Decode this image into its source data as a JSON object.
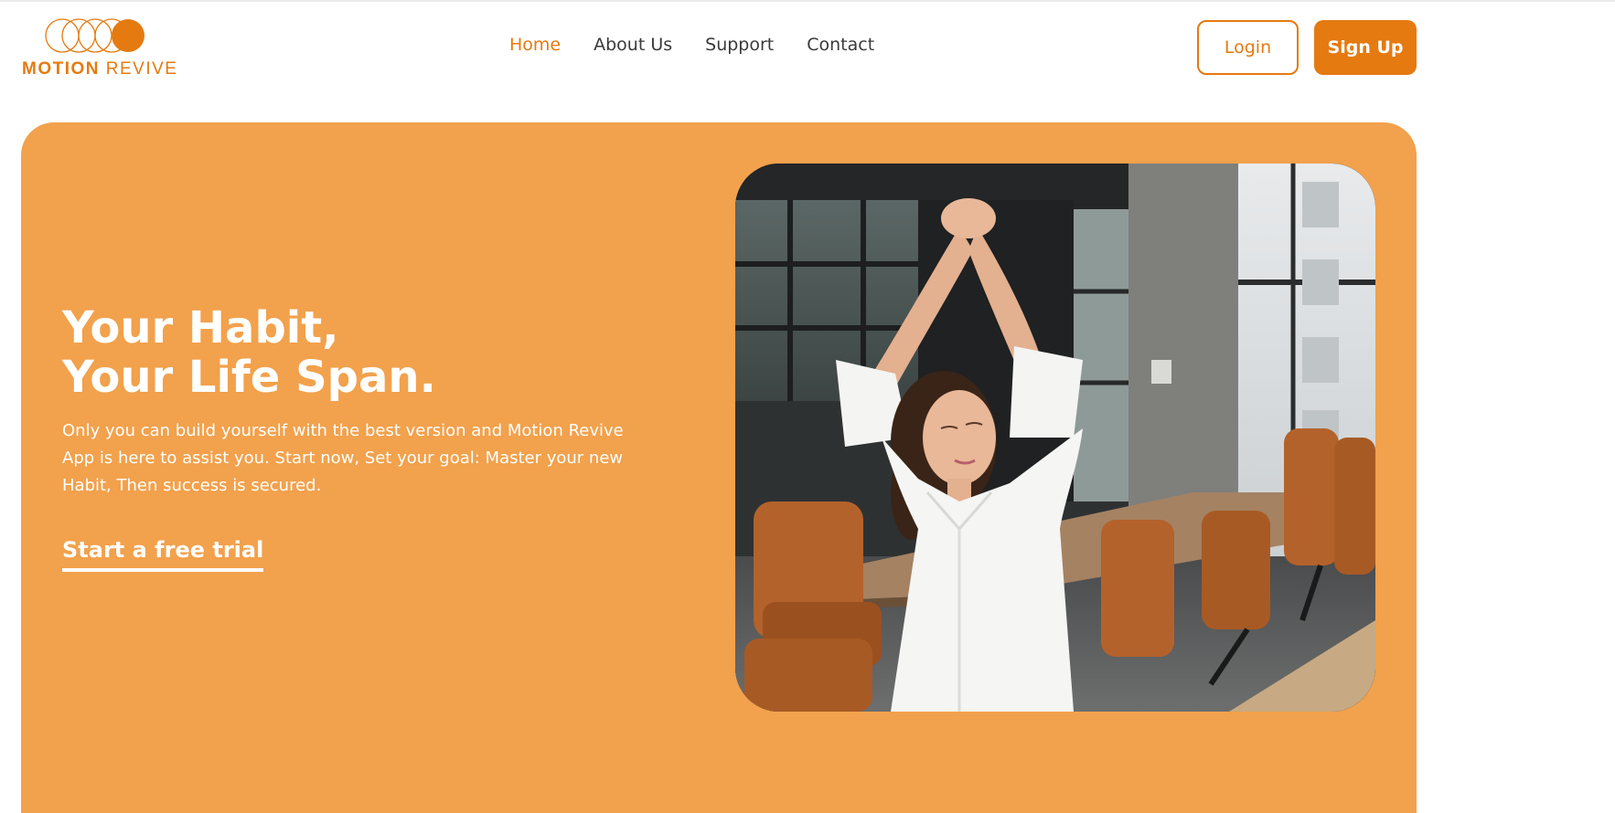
{
  "brand": {
    "name_bold": "MOTION",
    "name_light": "REVIVE",
    "accent_color": "#e57a10",
    "hero_color": "#f2a14c"
  },
  "nav": {
    "items": [
      {
        "label": "Home",
        "active": true
      },
      {
        "label": "About Us",
        "active": false
      },
      {
        "label": "Support",
        "active": false
      },
      {
        "label": "Contact",
        "active": false
      }
    ]
  },
  "auth": {
    "login_label": "Login",
    "signup_label": "Sign Up"
  },
  "hero": {
    "headline_line1": "Your Habit,",
    "headline_line2": "Your Life Span.",
    "description": "Only you can build yourself with the best version and Motion Revive App is here to assist you. Start now, Set your goal: Master your new Habit, Then success is secured.",
    "cta_label": "Start a free trial",
    "image_icon": "woman-stretching-office-photo"
  }
}
